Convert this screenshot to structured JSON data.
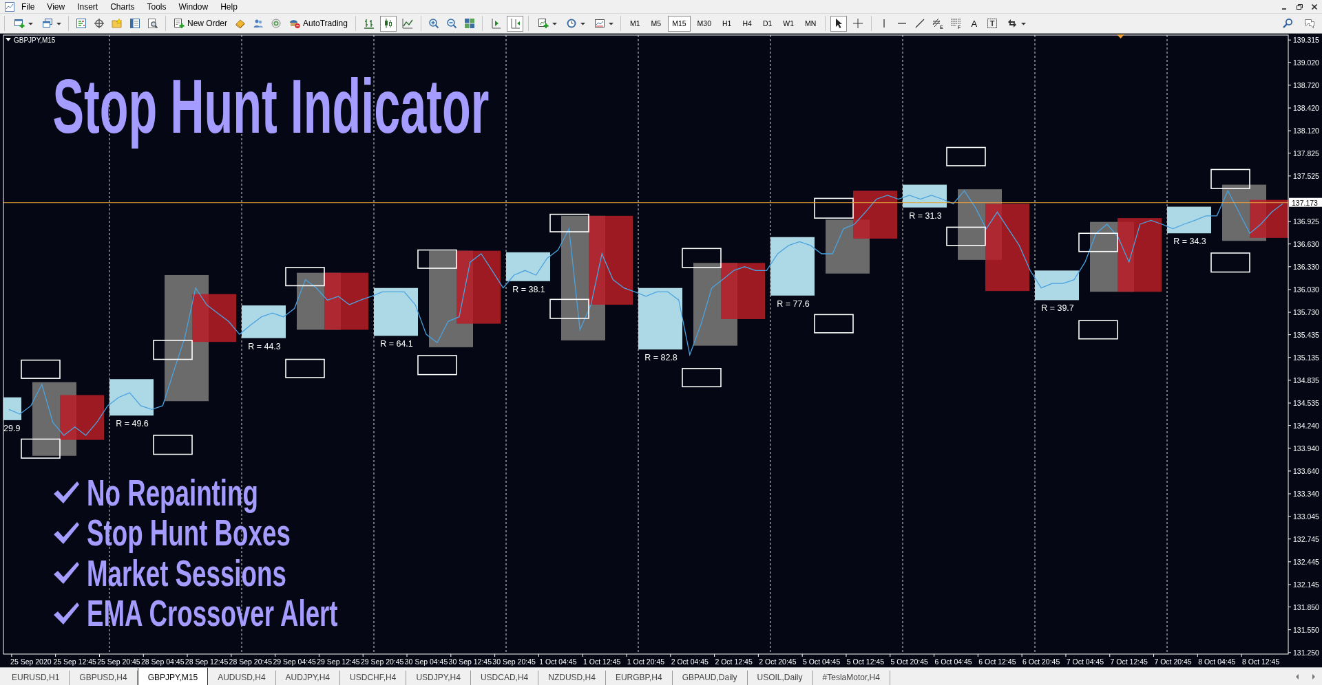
{
  "menu": {
    "items": [
      "File",
      "View",
      "Insert",
      "Charts",
      "Tools",
      "Window",
      "Help"
    ]
  },
  "toolbar": {
    "groups": [
      [
        {
          "kind": "new_chart",
          "dropdown": true
        },
        {
          "kind": "profiles",
          "dropdown": true
        }
      ],
      [
        {
          "kind": "market_watch"
        },
        {
          "kind": "navigator"
        },
        {
          "kind": "favorites"
        },
        {
          "kind": "terminal"
        },
        {
          "kind": "tester"
        }
      ],
      [
        {
          "kind": "new_order",
          "label": "New Order"
        },
        {
          "kind": "editor"
        },
        {
          "kind": "community"
        },
        {
          "kind": "signals"
        },
        {
          "kind": "autotrading",
          "label": "AutoTrading"
        }
      ],
      [
        {
          "kind": "bar_chart",
          "selected": false
        },
        {
          "kind": "candles",
          "selected": true
        },
        {
          "kind": "line_chart",
          "selected": false
        }
      ],
      [
        {
          "kind": "zoom_in"
        },
        {
          "kind": "zoom_out"
        },
        {
          "kind": "tile"
        }
      ],
      [
        {
          "kind": "chart_shift",
          "selected": false
        },
        {
          "kind": "autoscroll",
          "selected": true
        }
      ],
      [
        {
          "kind": "indicators",
          "dropdown": true
        },
        {
          "kind": "periods",
          "dropdown": true
        },
        {
          "kind": "templates",
          "dropdown": true
        }
      ],
      [
        {
          "kind": "timeframe",
          "label": "M1",
          "selected": false
        },
        {
          "kind": "timeframe",
          "label": "M5",
          "selected": false
        },
        {
          "kind": "timeframe",
          "label": "M15",
          "selected": true
        },
        {
          "kind": "timeframe",
          "label": "M30",
          "selected": false
        },
        {
          "kind": "timeframe",
          "label": "H1",
          "selected": false
        },
        {
          "kind": "timeframe",
          "label": "H4",
          "selected": false
        },
        {
          "kind": "timeframe",
          "label": "D1",
          "selected": false
        },
        {
          "kind": "timeframe",
          "label": "W1",
          "selected": false
        },
        {
          "kind": "timeframe",
          "label": "MN",
          "selected": false
        }
      ],
      [
        {
          "kind": "cursor",
          "selected": true
        },
        {
          "kind": "crosshair",
          "selected": false
        }
      ],
      [
        {
          "kind": "vline"
        },
        {
          "kind": "hline"
        },
        {
          "kind": "trendline"
        },
        {
          "kind": "channel",
          "badge": "E"
        },
        {
          "kind": "fibo",
          "badge": "F"
        },
        {
          "kind": "text",
          "label": "A"
        },
        {
          "kind": "label",
          "badge": "T"
        },
        {
          "kind": "arrows",
          "dropdown": true
        }
      ]
    ]
  },
  "chart": {
    "overlay": {
      "headline": "Stop Hunt Indicator",
      "features": [
        "No Repainting",
        "Stop Hunt Boxes",
        "Market Sessions",
        "EMA Crossover Alert"
      ]
    },
    "chart_data": {
      "type": "line",
      "title": "GBPJPY,M15",
      "ylim": [
        131.23,
        139.38
      ],
      "categories": [
        null,
        null,
        "25 Sep 2020",
        null,
        null,
        null,
        "25 Sep 12:45",
        null,
        null,
        null,
        "25 Sep 20:45",
        null,
        null,
        null,
        "28 Sep 04:45",
        null,
        null,
        null,
        "28 Sep 12:45",
        null,
        null,
        null,
        "28 Sep 20:45",
        null,
        null,
        null,
        "29 Sep 04:45",
        null,
        null,
        null,
        "29 Sep 12:45",
        null,
        null,
        null,
        "29 Sep 20:45",
        null,
        null,
        null,
        "30 Sep 04:45",
        null,
        null,
        null,
        "30 Sep 12:45",
        null,
        null,
        null,
        "30 Sep 20:45",
        null,
        null,
        null,
        "1 Oct 04:45",
        null,
        null,
        null,
        "1 Oct 12:45",
        null,
        null,
        null,
        "1 Oct 20:45",
        null,
        null,
        null,
        "2 Oct 04:45",
        null,
        null,
        null,
        "2 Oct 12:45",
        null,
        null,
        null,
        "2 Oct 20:45",
        null,
        null,
        null,
        "5 Oct 04:45",
        null,
        null,
        null,
        "5 Oct 12:45",
        null,
        null,
        null,
        "5 Oct 20:45",
        null,
        null,
        null,
        "6 Oct 04:45",
        null,
        null,
        null,
        "6 Oct 12:45",
        null,
        null,
        null,
        "6 Oct 20:45",
        null,
        null,
        null,
        "7 Oct 04:45",
        null,
        null,
        null,
        "7 Oct 12:45",
        null,
        null,
        null,
        "7 Oct 20:45",
        null,
        null,
        null,
        "8 Oct 04:45",
        null,
        null,
        null,
        "8 Oct 12:45",
        null,
        null
      ],
      "series": [
        {
          "color": "#4aa3df",
          "values": [
            134.45,
            134.39,
            134.5,
            134.78,
            134.28,
            134.11,
            134.22,
            134.11,
            134.28,
            134.5,
            134.61,
            134.67,
            134.5,
            134.45,
            134.5,
            134.95,
            135.39,
            136.05,
            135.83,
            135.72,
            135.61,
            135.44,
            135.56,
            135.67,
            135.72,
            135.67,
            135.78,
            136.16,
            136.05,
            135.89,
            135.94,
            135.83,
            135.89,
            135.94,
            136.0,
            136.0,
            136.0,
            135.83,
            135.44,
            135.33,
            135.61,
            135.67,
            136.39,
            136.5,
            136.28,
            136.05,
            136.22,
            136.28,
            136.22,
            136.44,
            136.55,
            136.83,
            135.5,
            135.83,
            136.5,
            136.16,
            136.05,
            136.0,
            135.94,
            136.0,
            136.0,
            135.89,
            135.17,
            135.56,
            136.05,
            136.16,
            136.28,
            136.33,
            136.28,
            136.28,
            136.5,
            136.61,
            136.66,
            136.61,
            136.5,
            136.5,
            136.83,
            136.89,
            137.05,
            137.22,
            137.27,
            137.22,
            137.27,
            137.22,
            137.27,
            137.22,
            137.16,
            137.33,
            137.11,
            136.83,
            137.05,
            136.83,
            136.61,
            136.28,
            136.05,
            136.11,
            136.11,
            136.16,
            136.39,
            136.77,
            136.89,
            136.72,
            136.39,
            136.89,
            136.94,
            136.89,
            136.83,
            136.89,
            136.94,
            137.0,
            137.0,
            137.33,
            137.05,
            136.77,
            136.89,
            137.05,
            137.16
          ]
        }
      ],
      "yticks": [
        139.315,
        {
          "value": 139.02,
          "label": "139.020"
        },
        {
          "value": 138.72,
          "label": "138.720"
        },
        {
          "value": 138.42,
          "label": "138.420"
        },
        {
          "value": 138.12,
          "label": "138.120"
        },
        137.825,
        137.525,
        136.925,
        {
          "value": 136.63,
          "label": "136.630"
        },
        {
          "value": 136.33,
          "label": "136.330"
        },
        {
          "value": 136.03,
          "label": "136.030"
        },
        {
          "value": 135.73,
          "label": "135.730"
        },
        135.435,
        135.135,
        134.835,
        134.535,
        {
          "value": 134.24,
          "label": "134.240"
        },
        {
          "value": 133.94,
          "label": "133.940"
        },
        {
          "value": 133.64,
          "label": "133.640"
        },
        {
          "value": 133.34,
          "label": "133.340"
        },
        133.045,
        132.745,
        132.445,
        132.145,
        {
          "value": 131.85,
          "label": "131.850"
        },
        {
          "value": 131.55,
          "label": "131.550"
        },
        {
          "value": 131.25,
          "label": "131.250"
        }
      ],
      "ref_lines": [
        {
          "axis": "y",
          "value": 137.173,
          "label": "137.173"
        }
      ],
      "annotations": [
        "29.9",
        "R = 49.6",
        "R = 44.3",
        "R = 64.1",
        "R = 38.1",
        "R = 82.8",
        "R = 77.6",
        "R = 31.3",
        "R = 39.7",
        "R = 34.3"
      ]
    }
  },
  "tabs": [
    {
      "label": "EURUSD,H1",
      "selected": false
    },
    {
      "label": "GBPUSD,H4",
      "selected": false
    },
    {
      "label": "GBPJPY,M15",
      "selected": true
    },
    {
      "label": "AUDUSD,H4",
      "selected": false
    },
    {
      "label": "AUDJPY,H4",
      "selected": false
    },
    {
      "label": "USDCHF,H4",
      "selected": false
    },
    {
      "label": "USDJPY,H4",
      "selected": false
    },
    {
      "label": "USDCAD,H4",
      "selected": false
    },
    {
      "label": "NZDUSD,H4",
      "selected": false
    },
    {
      "label": "EURGBP,H4",
      "selected": false
    },
    {
      "label": "GBPAUD,Daily",
      "selected": false
    },
    {
      "label": "USOIL,Daily",
      "selected": false
    },
    {
      "label": "#TeslaMotor,H4",
      "selected": false
    }
  ]
}
